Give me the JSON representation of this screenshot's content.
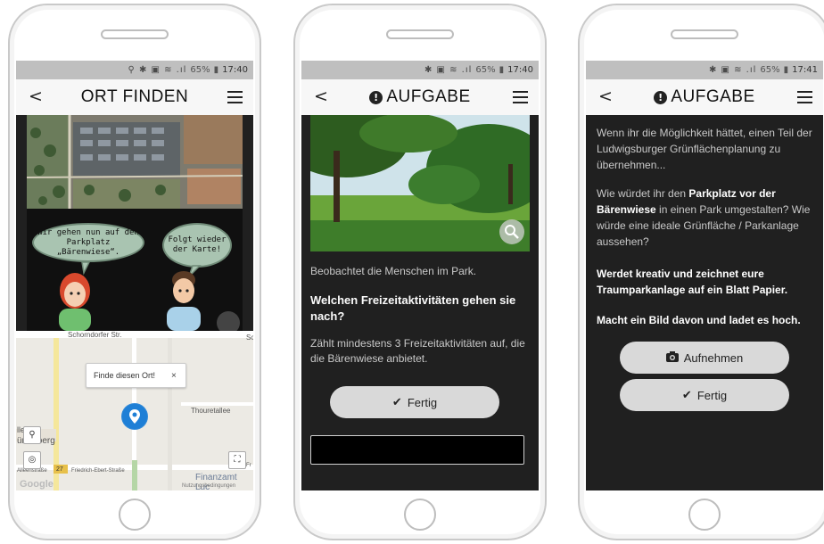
{
  "status_bars": [
    {
      "icons": "⚲ ✱ ▣ ≋ .ıl",
      "battery": "65%",
      "time": "17:40"
    },
    {
      "icons": "✱ ▣ ≋ .ıl",
      "battery": "65%",
      "time": "17:40"
    },
    {
      "icons": "✱ ▣ ≋ .ıl",
      "battery": "65%",
      "time": "17:41"
    }
  ],
  "screen1": {
    "back": "<",
    "title": "ORT FINDEN",
    "bubble_left": "Wir gehen nun auf den Parkplatz „Bärenwiese“.",
    "bubble_right": "Folgt wieder der Karte!",
    "map": {
      "street_top": "Schorndorfer Str.",
      "street_top_right": "Sc",
      "popup_text": "Finde diesen Ort!",
      "popup_close": "×",
      "street_right": "Thouretallee",
      "street_left_a": "lle",
      "street_left_b": "ürtenberg",
      "street_left_c": "Alleenstraße",
      "street_bottom": "Friedrich-Ebert-Straße",
      "route_badge": "27",
      "finanzamt": "Finanzamt Luc",
      "copyright": "Nutzungsbedingungen",
      "google": "Google",
      "fr_label": "Fr"
    }
  },
  "screen2": {
    "back": "<",
    "title": "AUFGABE",
    "observe": "Beobachtet die Menschen im Park.",
    "question": "Welchen Freizeitaktivitäten gehen sie nach?",
    "instruction": "Zählt mindestens 3 Freizeitaktivitäten auf, die die Bärenwiese anbietet.",
    "done_label": "Fertig",
    "answer_value": ""
  },
  "screen3": {
    "back": "<",
    "title": "AUFGABE",
    "intro": "Wenn ihr die Möglichkeit hättet, einen Teil der Ludwigsburger Grünflächenplanung zu übernehmen...",
    "q_pre": "Wie würdet ihr den ",
    "q_bold": "Parkplatz vor der Bärenwiese",
    "q_post": " in einen Park umgestalten? Wie würde eine ideale Grünfläche / Parkanlage aussehen?",
    "creative": "Werdet kreativ und zeichnet eure Traumparkanlage auf ein Blatt Papier.",
    "upload": "Macht ein Bild davon und ladet es hoch.",
    "capture_label": "Aufnehmen",
    "done_label": "Fertig"
  },
  "colors": {
    "screen_bg": "#202020",
    "appbar_bg": "#f7f7f7",
    "statusbar_bg": "#bfbfbf",
    "button_bg": "#d9d9d9",
    "map_pin": "#1e7fd6",
    "bubble_green": "#a9c4b1"
  },
  "icons": [
    "back-icon",
    "menu-icon",
    "alert-icon",
    "magnifier-icon",
    "check-icon",
    "camera-icon",
    "map-pin-icon",
    "locate-icon",
    "fullscreen-icon"
  ]
}
